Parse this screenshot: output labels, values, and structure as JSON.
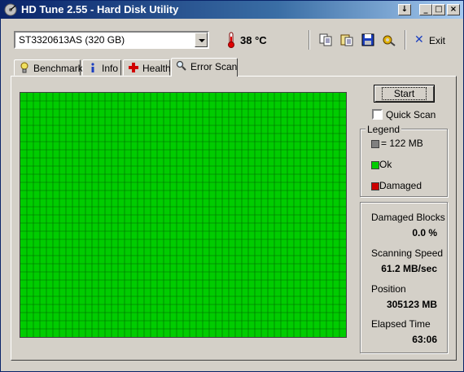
{
  "window": {
    "title": "HD Tune 2.55 - Hard Disk Utility",
    "controls": {
      "dropdown": "↓",
      "minimize": "_",
      "maximize": "□",
      "close": "×"
    }
  },
  "toolbar": {
    "drive": "ST3320613AS (320 GB)",
    "temperature": "38 °C",
    "icons": [
      "copy-icon",
      "copy-info-icon",
      "save-icon",
      "options-icon"
    ],
    "exit_label": "Exit"
  },
  "tabs": [
    {
      "label": "Benchmark",
      "icon": "benchmark-icon",
      "active": false
    },
    {
      "label": "Info",
      "icon": "info-icon",
      "active": false
    },
    {
      "label": "Health",
      "icon": "health-icon",
      "active": false
    },
    {
      "label": "Error Scan",
      "icon": "magnifier-icon",
      "active": true
    }
  ],
  "scan": {
    "start_label": "Start",
    "quick_scan_label": "Quick Scan",
    "quick_scan_checked": false,
    "grid": {
      "columns": 50,
      "rows": 30,
      "ok_color": "#00cc00",
      "line_color": "#006600"
    }
  },
  "legend": {
    "title": "Legend",
    "block_size": "= 122 MB",
    "ok": "Ok",
    "damaged": "Damaged",
    "colors": {
      "block": "#808080",
      "ok": "#00cc00",
      "damaged": "#cc0000"
    }
  },
  "stats": {
    "damaged_blocks_label": "Damaged Blocks",
    "damaged_blocks_value": "0.0 %",
    "speed_label": "Scanning Speed",
    "speed_value": "61.2 MB/sec",
    "position_label": "Position",
    "position_value": "305123 MB",
    "elapsed_label": "Elapsed Time",
    "elapsed_value": "63:06"
  }
}
